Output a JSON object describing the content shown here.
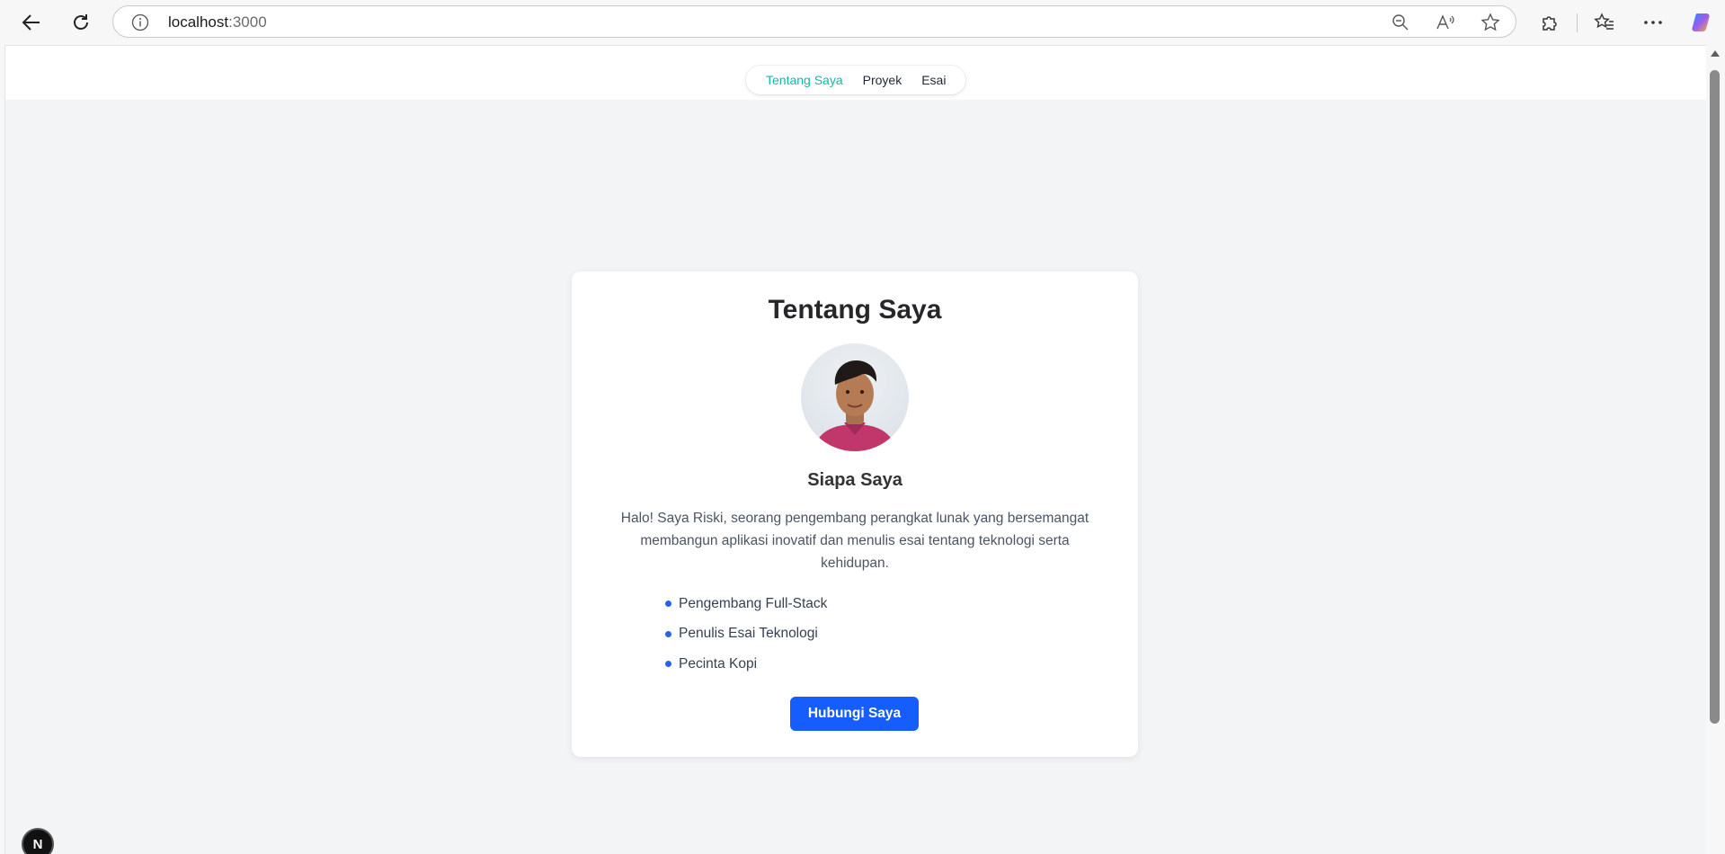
{
  "browser": {
    "url_host": "localhost",
    "url_port": ":3000",
    "icons": [
      "back-arrow-icon",
      "refresh-icon",
      "info-icon",
      "zoom-out-icon",
      "read-aloud-icon",
      "favorite-star-icon",
      "extensions-icon",
      "favorites-icon",
      "more-icon",
      "copilot-icon"
    ]
  },
  "nav": {
    "items": [
      {
        "label": "Tentang Saya",
        "active": true
      },
      {
        "label": "Proyek",
        "active": false
      },
      {
        "label": "Esai",
        "active": false
      }
    ]
  },
  "card": {
    "title": "Tentang Saya",
    "subtitle": "Siapa Saya",
    "bio": "Halo! Saya Riski, seorang pengembang perangkat lunak yang bersemangat membangun aplikasi inovatif dan menulis esai tentang teknologi serta kehidupan.",
    "skills": [
      "Pengembang Full-Stack",
      "Penulis Esai Teknologi",
      "Pecinta Kopi"
    ],
    "button_label": "Hubungi Saya"
  },
  "next_badge": "N",
  "colors": {
    "accent_nav": "#14b8a6",
    "button": "#155dfc",
    "bullet": "#2563eb",
    "page_bg": "#f3f4f6"
  }
}
